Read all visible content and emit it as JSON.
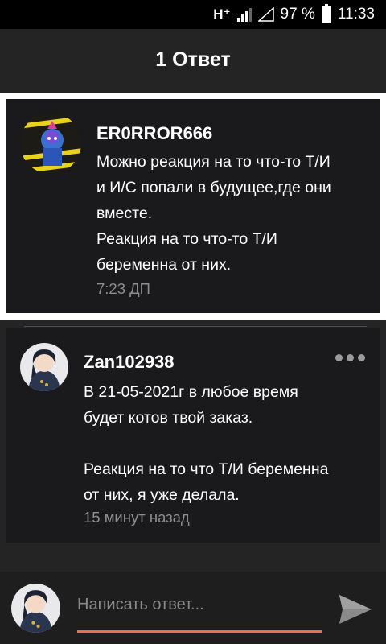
{
  "status_bar": {
    "network": "H⁺",
    "battery": "97 %",
    "time": "11:33"
  },
  "header": {
    "title": "1 Ответ"
  },
  "root_comment": {
    "username": "ER0RROR666",
    "text": "Можно реакция на то что-то Т/И\nи И/С попали в будущее,где они\nвместе.\nРеакция на то что-то Т/И\nбеременна от них.",
    "time": "7:23 ДП"
  },
  "reply": {
    "username": "Zan102938",
    "text": "В 21-05-2021г в любое время\nбудет котов твой заказ.\n\nРеакция на то что Т/И беременна\nот них, я уже делала.",
    "time": "15 минут назад"
  },
  "composer": {
    "placeholder": "Написать ответ..."
  },
  "colors": {
    "accent": "#e8734a",
    "background": "#242424",
    "card": "#1a1a1c"
  },
  "icons": {
    "more": "more-dots-icon",
    "send": "send-icon"
  }
}
